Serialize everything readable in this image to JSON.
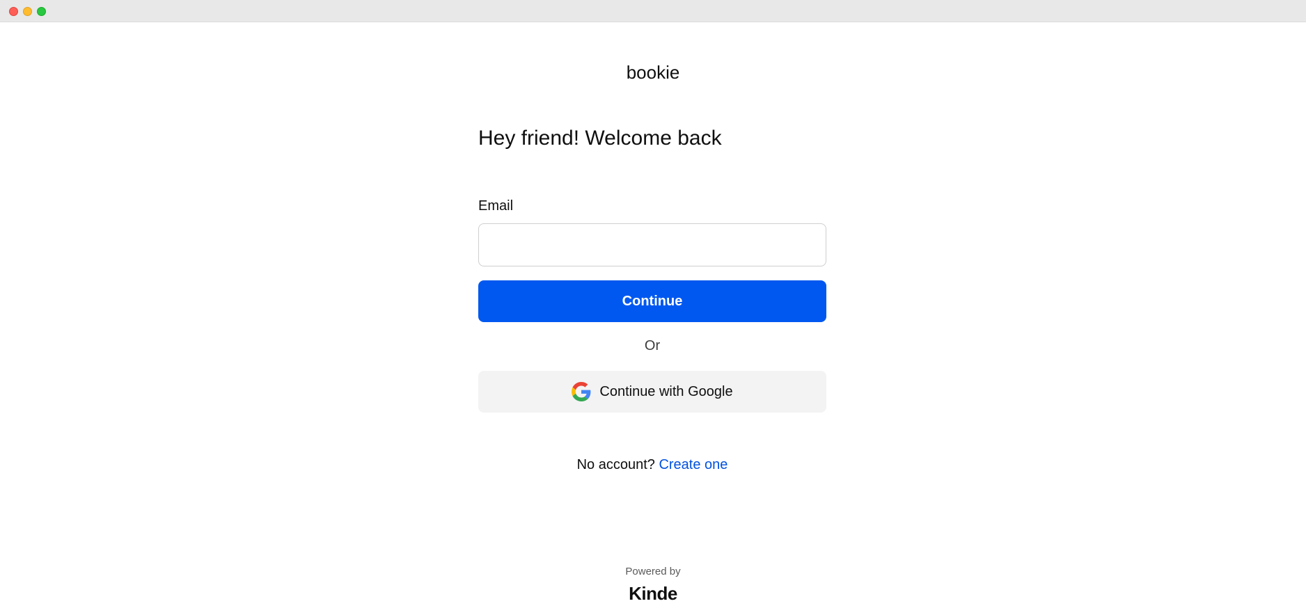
{
  "window": {
    "controls": [
      "close",
      "minimize",
      "maximize"
    ]
  },
  "brand": {
    "name": "bookie"
  },
  "login": {
    "heading": "Hey friend! Welcome back",
    "email_label": "Email",
    "email_value": "",
    "email_placeholder": "",
    "continue_label": "Continue",
    "divider_text": "Or",
    "google_label": "Continue with Google",
    "google_icon": "google-icon",
    "signup_prompt": "No account?",
    "signup_link": "Create one"
  },
  "footer": {
    "powered_by": "Powered by",
    "provider": "Kinde"
  },
  "colors": {
    "primary": "#0058f0",
    "link": "#0051e0",
    "secondary_button_bg": "#f3f3f3"
  }
}
